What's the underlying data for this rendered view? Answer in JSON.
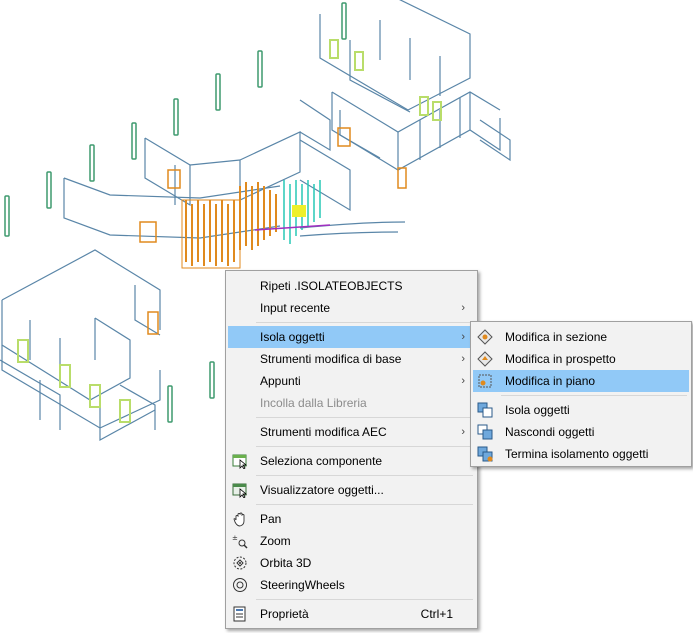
{
  "context_menu": {
    "items": [
      {
        "label": "Ripeti .ISOLATEOBJECTS"
      },
      {
        "label": "Input recente"
      },
      {
        "label": "Isola oggetti"
      },
      {
        "label": "Strumenti modifica di base"
      },
      {
        "label": "Appunti"
      },
      {
        "label": "Incolla dalla Libreria"
      },
      {
        "label": "Strumenti modifica AEC"
      },
      {
        "label": "Seleziona componente"
      },
      {
        "label": "Visualizzatore oggetti..."
      },
      {
        "label": "Pan"
      },
      {
        "label": "Zoom"
      },
      {
        "label": "Orbita 3D"
      },
      {
        "label": "SteeringWheels"
      },
      {
        "label": "Proprietà",
        "shortcut": "Ctrl+1"
      }
    ]
  },
  "submenu": {
    "items": [
      {
        "label": "Modifica in sezione"
      },
      {
        "label": "Modifica in prospetto"
      },
      {
        "label": "Modifica in piano"
      },
      {
        "label": "Isola oggetti"
      },
      {
        "label": "Nascondi oggetti"
      },
      {
        "label": "Termina isolamento oggetti"
      }
    ]
  },
  "colors": {
    "highlight": "#91c9f7",
    "menu_bg": "#f2f2f2",
    "wall_line": "#5a86a8",
    "orange": "#e08a1e",
    "green": "#3e9a6e",
    "lime": "#b9dd6a",
    "cyan": "#27c9b6"
  }
}
